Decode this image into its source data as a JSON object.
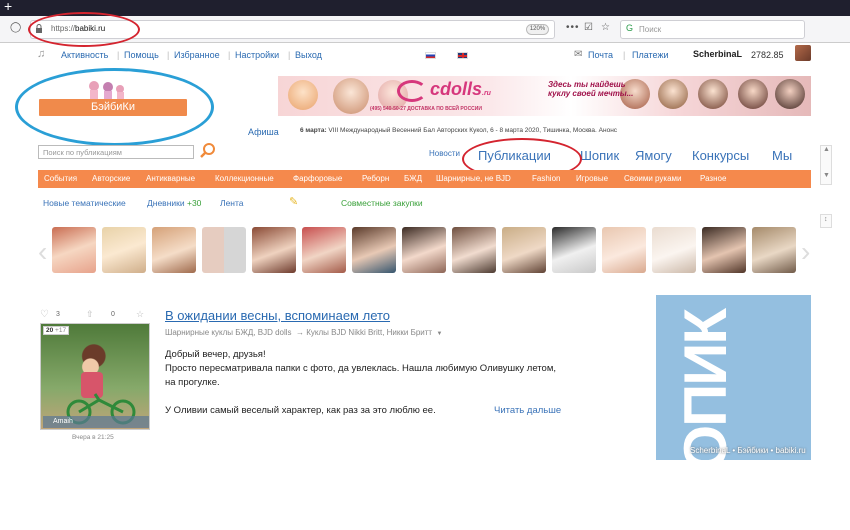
{
  "browser": {
    "url_prefix": "https://",
    "url_host": "babiki.ru",
    "zoom": "120%",
    "search_placeholder": "Поиск"
  },
  "topmenu": {
    "activity": "Активность",
    "help": "Помощь",
    "favorites": "Избранное",
    "settings": "Настройки",
    "logout": "Выход",
    "mail": "Почта",
    "payments": "Платежи",
    "username": "ScherbinaL",
    "balance": "2782.85"
  },
  "logo": {
    "text": "БэйбиКи"
  },
  "banner": {
    "brand": "cdolls",
    "brand_suffix": ".ru",
    "phone_line": "(495) 540-50-27  ДОСТАВКА ПО ВСЕЙ РОССИИ",
    "slogan": "Здесь ты найдешь куклу своей мечты..."
  },
  "afisha": {
    "label": "Афиша",
    "date": "6 марта:",
    "text": "VIII Международный Весенний Бал Авторских Кукол, 6 - 8 марта 2020, Тишинка, Москва. Анонс"
  },
  "search": {
    "placeholder": "Поиск по публикациям"
  },
  "sections": {
    "news": "Новости",
    "publications": "Публикации",
    "shop": "Шопик",
    "yamogu": "Ямогу",
    "contests": "Конкурсы",
    "we": "Мы"
  },
  "categories": [
    "События",
    "Авторские",
    "Антикварные",
    "Коллекционные",
    "Фарфоровые",
    "Реборн",
    "БЖД",
    "Шарнирные, не BJD",
    "Fashion",
    "Игровые",
    "Своими руками",
    "Разное"
  ],
  "subnav": {
    "thematic": "Новые тематические",
    "diaries": "Дневники",
    "diaries_count": "+30",
    "feed": "Лента",
    "joint": "Совместные закупки"
  },
  "post": {
    "likes": "3",
    "comments": "0",
    "photo_count": "20",
    "photo_extra": "+17",
    "author": "Amaih",
    "time": "Вчера в 21:25",
    "title": "В ожидании весны, вспоминаем лето",
    "cat1": "Шарнирные куклы БЖД, BJD dolls",
    "cat2": "→ Куклы BJD Nikki Britt, Никки Бритт",
    "line1": "Добрый вечер, друзья!",
    "line2": "Просто пересматривала папки с фото, да увлеклась. Нашла любимую Оливушку летом,",
    "line3": "на прогулке.",
    "line4": "У Оливии самый веселый характер, как раз за это люблю ее.",
    "read_more": "Читать дальше"
  },
  "ad": {
    "text": "ШОПИК"
  },
  "watermark": "ScherbinaL • Бэйбики • babiki.ru",
  "colors": {
    "accent": "#f5894c",
    "link": "#2a6ab1",
    "annotation_red": "#d4242f",
    "annotation_blue": "#2a9fd6"
  }
}
